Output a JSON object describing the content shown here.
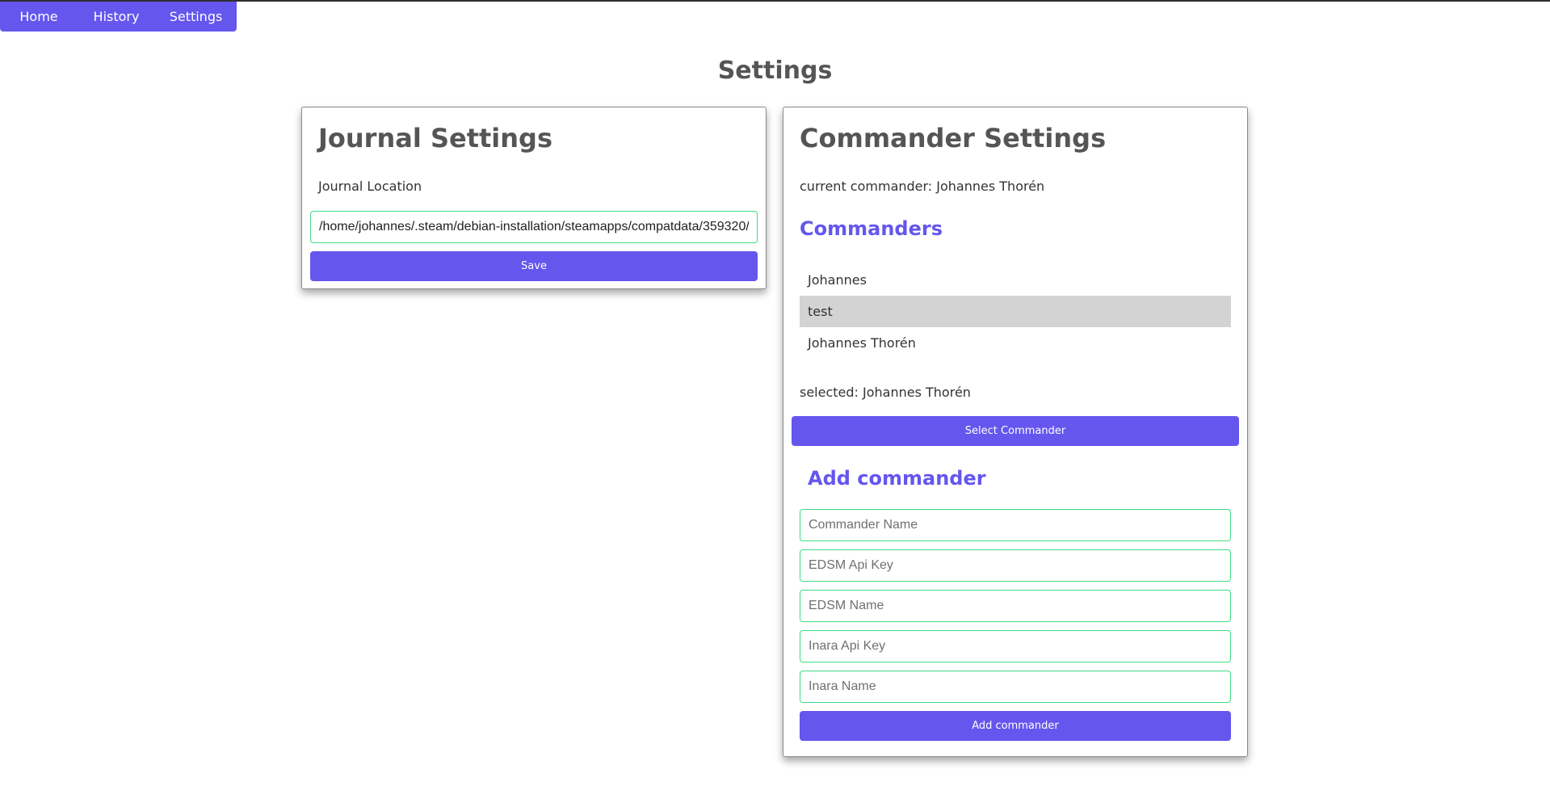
{
  "nav": {
    "items": [
      {
        "label": "Home"
      },
      {
        "label": "History"
      },
      {
        "label": "Settings"
      }
    ]
  },
  "page": {
    "title": "Settings"
  },
  "journal": {
    "title": "Journal Settings",
    "location_label": "Journal Location",
    "location_value": "/home/johannes/.steam/debian-installation/steamapps/compatdata/359320/",
    "save_label": "Save"
  },
  "commander": {
    "title": "Commander Settings",
    "current_text": "current commander: Johannes Thorén",
    "list_title": "Commanders",
    "list": [
      {
        "name": "Johannes"
      },
      {
        "name": "test"
      },
      {
        "name": "Johannes Thorén"
      }
    ],
    "highlighted_index": 1,
    "selected_text": "selected: Johannes Thorén",
    "select_button_label": "Select Commander",
    "add_title": "Add commander",
    "fields": {
      "name_placeholder": "Commander Name",
      "edsm_key_placeholder": "EDSM Api Key",
      "edsm_name_placeholder": "EDSM Name",
      "inara_key_placeholder": "Inara Api Key",
      "inara_name_placeholder": "Inara Name"
    },
    "add_button_label": "Add commander"
  },
  "colors": {
    "accent": "#6556ee",
    "input_border": "#3ddc84",
    "highlight_row": "#d3d3d3"
  }
}
